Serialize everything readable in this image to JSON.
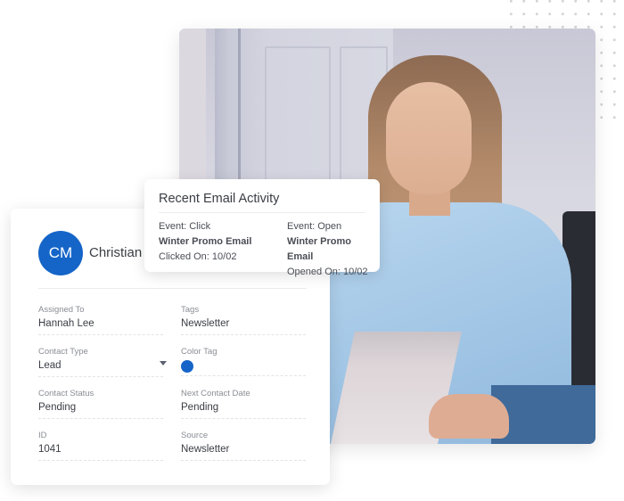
{
  "email_activity": {
    "title": "Recent Email Activity",
    "events": [
      {
        "event": "Event: Click",
        "campaign": "Winter Promo Email",
        "date": "Clicked On: 10/02"
      },
      {
        "event": "Event: Open",
        "campaign": "Winter Promo Email",
        "date": "Opened On: 10/02"
      }
    ]
  },
  "contact": {
    "initials": "CM",
    "name": "Christian",
    "avatar_color": "#1565c8",
    "fields": {
      "assigned_to": {
        "label": "Assigned To",
        "value": "Hannah Lee"
      },
      "tags": {
        "label": "Tags",
        "value": "Newsletter"
      },
      "contact_type": {
        "label": "Contact Type",
        "value": "Lead"
      },
      "color_tag": {
        "label": "Color Tag",
        "color": "#1565c8"
      },
      "contact_status": {
        "label": "Contact Status",
        "value": "Pending"
      },
      "next_contact_date": {
        "label": "Next Contact Date",
        "value": "Pending"
      },
      "id": {
        "label": "ID",
        "value": "1041"
      },
      "source": {
        "label": "Source",
        "value": "Newsletter"
      }
    }
  },
  "photo": {
    "description": "Woman in light blue shirt sitting with laptop"
  }
}
